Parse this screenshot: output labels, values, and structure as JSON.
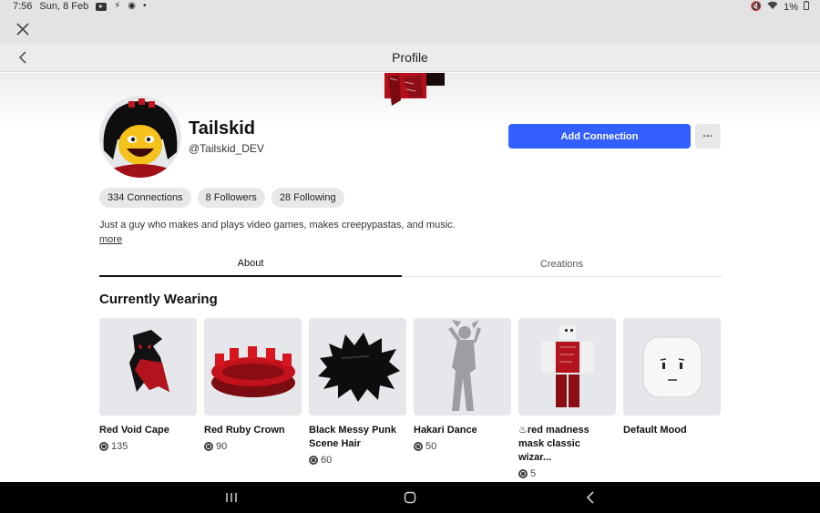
{
  "statusbar": {
    "time": "7:56",
    "date": "Sun, 8 Feb",
    "dot": "•",
    "battery": "1%"
  },
  "header": {
    "title": "Profile"
  },
  "profile": {
    "display_name": "Tailskid",
    "username": "@Tailskid_DEV",
    "add_connection_label": "Add Connection",
    "more_label": "···",
    "connections": "334 Connections",
    "followers": "8 Followers",
    "following": "28 Following",
    "bio": "Just a guy who makes and plays video games, makes creepypastas, and music.",
    "more_link": "more"
  },
  "tabs": [
    {
      "label": "About",
      "active": true
    },
    {
      "label": "Creations",
      "active": false
    }
  ],
  "currently_wearing": {
    "title": "Currently Wearing",
    "items": [
      {
        "name": "Red Void Cape",
        "price": "135",
        "icon": "cape-icon"
      },
      {
        "name": "Red Ruby Crown",
        "price": "90",
        "icon": "crown-icon"
      },
      {
        "name": "Black Messy Punk Scene Hair",
        "price": "60",
        "icon": "hair-icon"
      },
      {
        "name": "Hakari Dance",
        "price": "50",
        "icon": "dance-emote-icon"
      },
      {
        "name": "♨red madness mask classic wizar...",
        "price": "5",
        "icon": "mask-outfit-icon"
      },
      {
        "name": "Default Mood",
        "price": "",
        "icon": "default-face-icon"
      }
    ]
  },
  "colors": {
    "accent": "#335fff",
    "pill_bg": "#e8e8ea",
    "thumb_bg": "#e6e7ea",
    "nav_bg": "#000000"
  }
}
